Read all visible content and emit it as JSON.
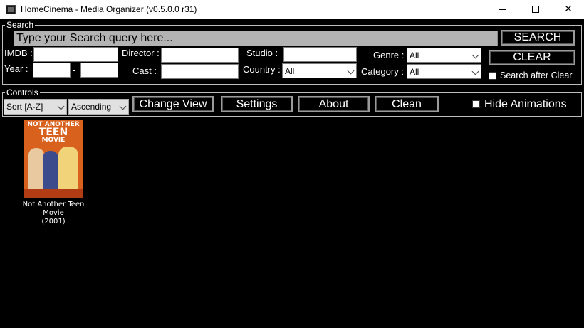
{
  "window": {
    "title": "HomeCinema - Media Organizer (v0.5.0.0 r31)",
    "minimize_glyph": "",
    "maximize_glyph": "",
    "close_glyph": "✕"
  },
  "search": {
    "group_label": "Search",
    "query_placeholder": "Type your Search query here...",
    "search_button": "SEARCH",
    "clear_button": "CLEAR",
    "search_after_clear_label": "Search after Clear",
    "search_after_clear_checked": false,
    "fields": {
      "imdb_label": "IMDB :",
      "imdb_value": "",
      "year_label": "Year :",
      "year_from": "",
      "year_sep": "-",
      "year_to": "",
      "director_label": "Director :",
      "director_value": "",
      "cast_label": "Cast :",
      "cast_value": "",
      "studio_label": "Studio :",
      "studio_value": "",
      "country_label": "Country :",
      "country_value": "All",
      "genre_label": "Genre :",
      "genre_value": "All",
      "category_label": "Category :",
      "category_value": "All"
    }
  },
  "controls": {
    "group_label": "Controls",
    "sort_value": "Sort [A-Z]",
    "order_value": "Ascending",
    "change_view_button": "Change View",
    "settings_button": "Settings",
    "about_button": "About",
    "clean_button": "Clean",
    "hide_animations_label": "Hide Animations",
    "hide_animations_checked": false
  },
  "media": [
    {
      "title": "Not Another Teen Movie",
      "year": "(2001)",
      "poster_text_top": "NOT ANOTHER",
      "poster_text_big": "TEEN",
      "poster_text_bottom": "MOVIE"
    }
  ],
  "colors": {
    "background": "#000000",
    "frame": "#bdbdbd",
    "search_box": "#b3b3b3",
    "button_border": "#9a9a9a",
    "poster": "#d8611d"
  }
}
